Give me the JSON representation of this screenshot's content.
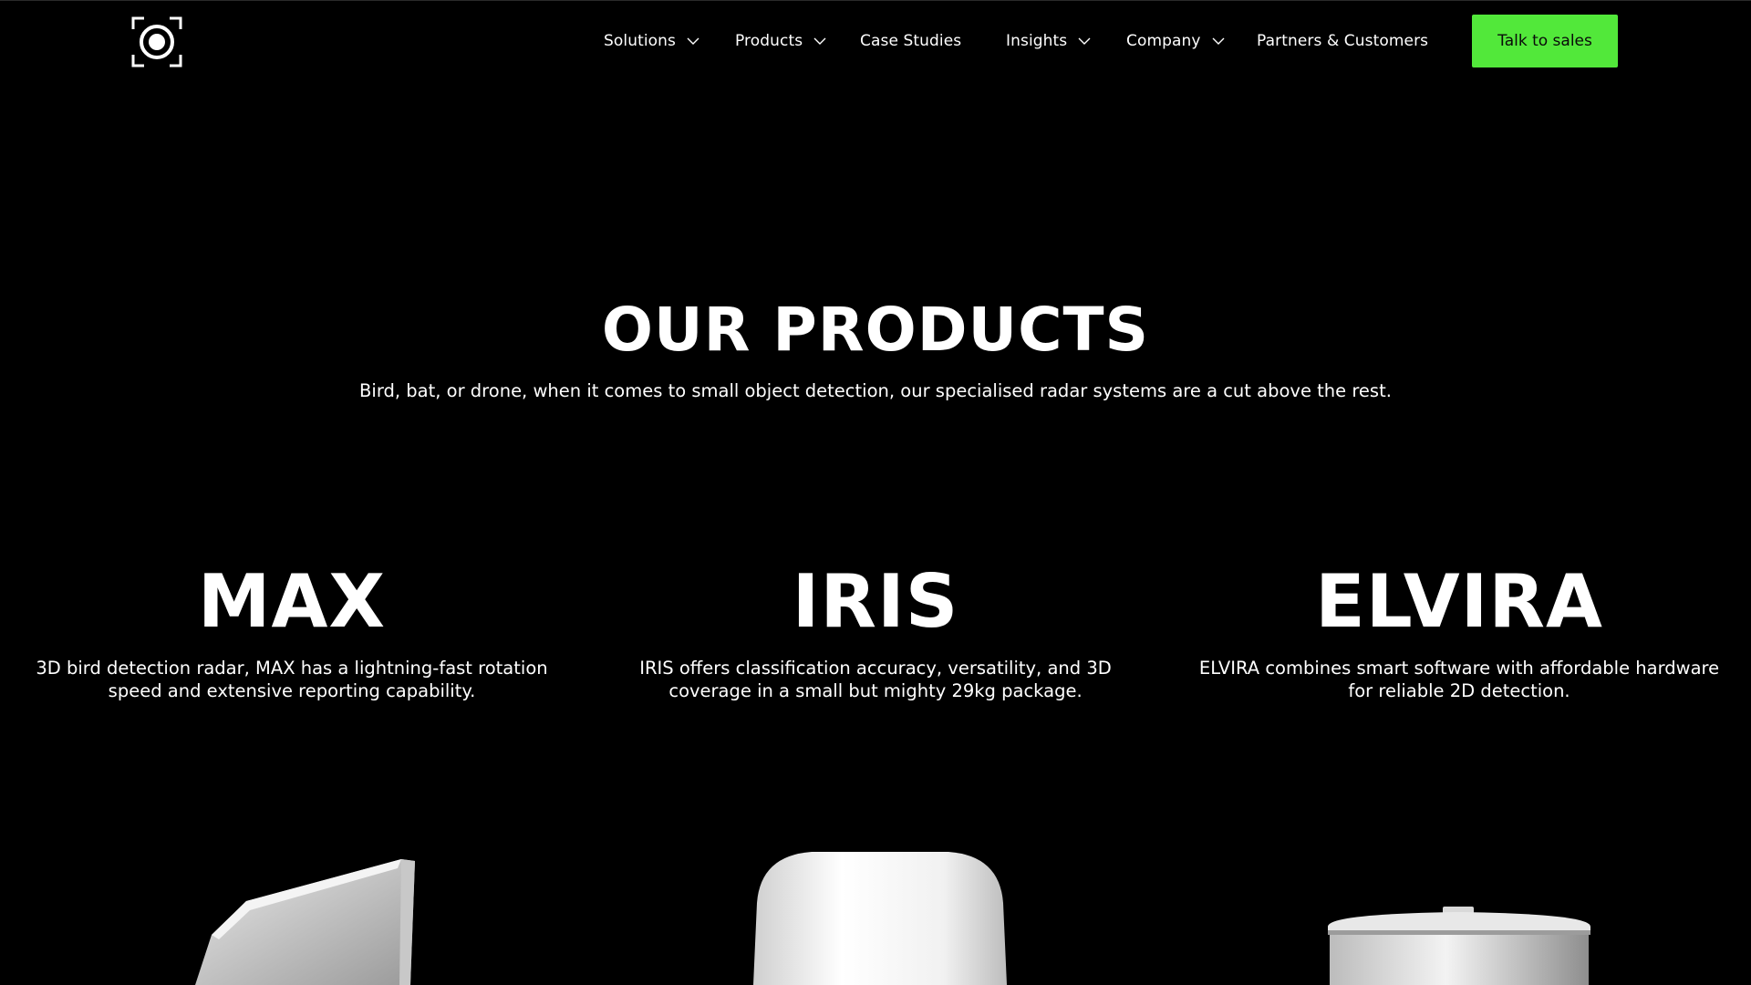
{
  "header": {
    "logo_icon": "target-ring-icon",
    "nav": [
      {
        "label": "Solutions",
        "has_dropdown": true
      },
      {
        "label": "Products",
        "has_dropdown": true
      },
      {
        "label": "Case Studies",
        "has_dropdown": false
      },
      {
        "label": "Insights",
        "has_dropdown": true
      },
      {
        "label": "Company",
        "has_dropdown": true
      },
      {
        "label": "Partners & Customers",
        "has_dropdown": false
      }
    ],
    "cta_label": "Talk to sales",
    "cta_color": "#52e83a"
  },
  "hero": {
    "title": "OUR PRODUCTS",
    "subtitle": "Bird, bat, or drone, when it comes to small object detection, our specialised radar systems are a cut above the rest."
  },
  "products": [
    {
      "name": "MAX",
      "description": "3D bird detection radar, MAX has a lightning-fast rotation speed and extensive reporting capability."
    },
    {
      "name": "IRIS",
      "description": "IRIS offers classification accuracy, versatility, and 3D coverage in a small but mighty 29kg package."
    },
    {
      "name": "ELVIRA",
      "description": "ELVIRA combines smart software with affordable hardware for reliable 2D detection."
    }
  ],
  "colors": {
    "background": "#000000",
    "text": "#ffffff",
    "accent": "#52e83a"
  }
}
